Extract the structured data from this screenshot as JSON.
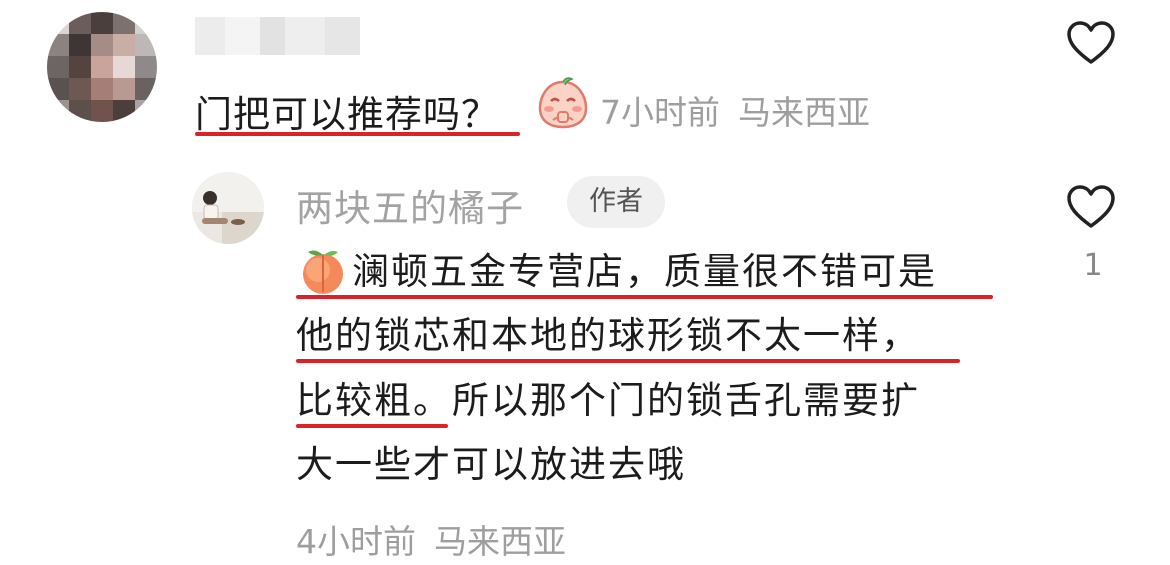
{
  "comment": {
    "text": "门把可以推荐吗？",
    "emoji": "peach-face-sticker",
    "time": "7小时前",
    "location": "马来西亚",
    "like_icon": "heart-outline-icon"
  },
  "reply": {
    "author": "两块五的橘子",
    "author_tag": "作者",
    "emoji": "peach",
    "lines": [
      "澜顿五金专营店，质量很不错可是",
      "他的锁芯和本地的球形锁不太一样，",
      "比较粗。所以那个门的锁舌孔需要扩",
      "大一些才可以放进去哦"
    ],
    "time": "4小时前",
    "location": "马来西亚",
    "likes": "1",
    "like_icon": "heart-outline-icon"
  },
  "colors": {
    "underline": "#d8232a",
    "meta": "#9e9e9e",
    "text": "#1c1c1c"
  }
}
